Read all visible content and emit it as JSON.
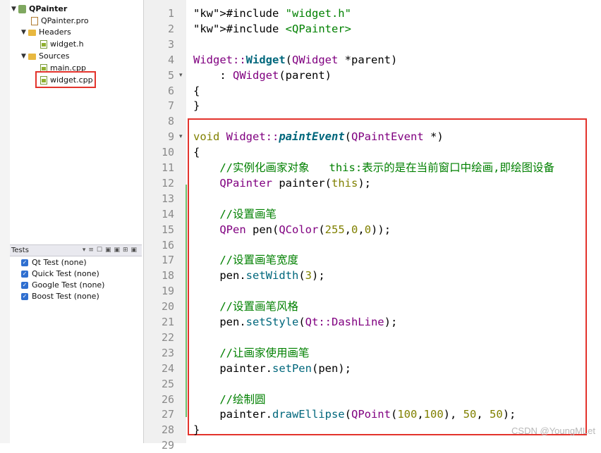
{
  "project_tree": {
    "project_name": "QPainter",
    "items": [
      {
        "label": "QPainter",
        "icon": "project-icon"
      },
      {
        "label": "QPainter.pro",
        "icon": "pro-file-icon"
      },
      {
        "label": "Headers",
        "icon": "folder-icon"
      },
      {
        "label": "widget.h",
        "icon": "header-file-icon"
      },
      {
        "label": "Sources",
        "icon": "folder-icon"
      },
      {
        "label": "main.cpp",
        "icon": "source-file-icon"
      },
      {
        "label": "widget.cpp",
        "icon": "source-file-icon",
        "highlighted": true
      }
    ]
  },
  "tests": {
    "title": "Tests",
    "items": [
      {
        "label": "Qt Test (none)",
        "checked": true
      },
      {
        "label": "Quick Test (none)",
        "checked": true
      },
      {
        "label": "Google Test (none)",
        "checked": true
      },
      {
        "label": "Boost Test (none)",
        "checked": true
      }
    ]
  },
  "editor": {
    "line_numbers": [
      "1",
      "2",
      "3",
      "4",
      "5",
      "6",
      "7",
      "8",
      "9",
      "10",
      "11",
      "12",
      "13",
      "14",
      "15",
      "16",
      "17",
      "18",
      "19",
      "20",
      "21",
      "22",
      "23",
      "24",
      "25",
      "26",
      "27",
      "28",
      "29"
    ],
    "lines": [
      "#include \"widget.h\"",
      "#include <QPainter>",
      "",
      "Widget::Widget(QWidget *parent)",
      "    : QWidget(parent)",
      "{",
      "}",
      "",
      "void Widget::paintEvent(QPaintEvent *)",
      "{",
      "    //实例化画家对象   this:表示的是在当前窗口中绘画,即绘图设备",
      "    QPainter painter(this);",
      "",
      "    //设置画笔",
      "    QPen pen(QColor(255,0,0));",
      "",
      "    //设置画笔宽度",
      "    pen.setWidth(3);",
      "",
      "    //设置画笔风格",
      "    pen.setStyle(Qt::DashLine);",
      "",
      "    //让画家使用画笔",
      "    painter.setPen(pen);",
      "",
      "    //绘制圆",
      "    painter.drawEllipse(QPoint(100,100), 50, 50);",
      "}",
      ""
    ]
  },
  "watermark": "CSDN @YoungMLet",
  "colors": {
    "highlight_border": "#e3332c",
    "change_bar": "#6cc06c"
  }
}
